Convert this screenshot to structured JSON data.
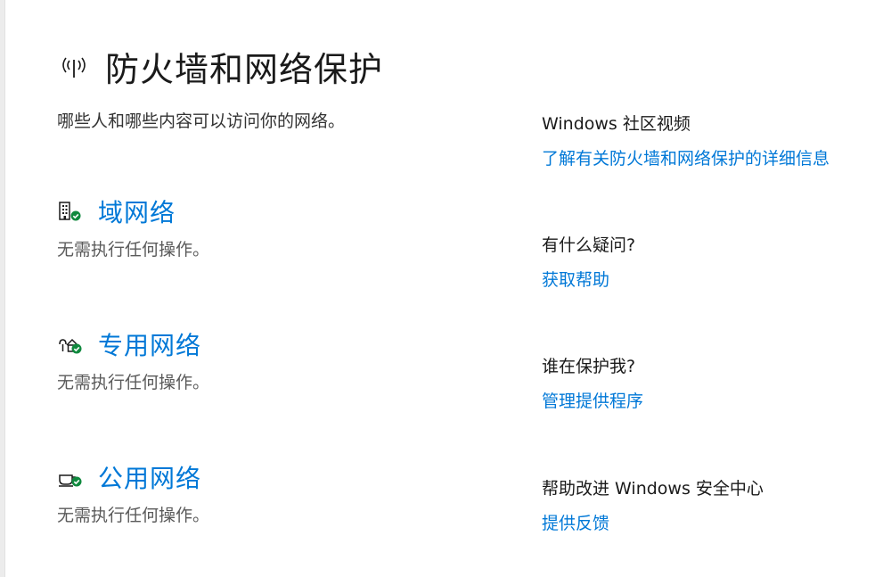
{
  "header": {
    "title": "防火墙和网络保护",
    "title_icon": "antenna-broadcast-icon",
    "subtitle": "哪些人和哪些内容可以访问你的网络。"
  },
  "networks": [
    {
      "label": "域网络",
      "status": "无需执行任何操作。",
      "icon": "domain-network-icon"
    },
    {
      "label": "专用网络",
      "status": "无需执行任何操作。",
      "icon": "private-network-icon"
    },
    {
      "label": "公用网络",
      "status": "无需执行任何操作。",
      "icon": "public-network-icon"
    }
  ],
  "sidebar": {
    "video": {
      "heading": "Windows 社区视频",
      "link": "了解有关防火墙和网络保护的详细信息"
    },
    "help": {
      "heading": "有什么疑问?",
      "link": "获取帮助"
    },
    "providers": {
      "heading": "谁在保护我?",
      "link": "管理提供程序"
    },
    "feedback": {
      "heading": "帮助改进 Windows 安全中心",
      "link": "提供反馈"
    }
  },
  "colors": {
    "accent": "#0078d7",
    "ok_badge": "#10893e",
    "text_primary": "#1a1a1a",
    "text_secondary": "#5a5a5a"
  }
}
